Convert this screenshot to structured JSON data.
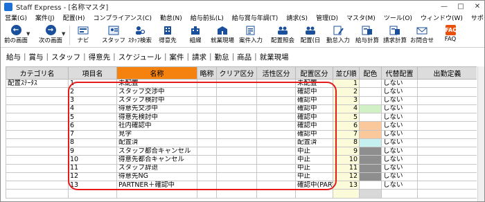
{
  "window": {
    "title": "Staff Express - [名称マスタ]"
  },
  "window_buttons": [
    "—",
    "□",
    "✕"
  ],
  "menu": [
    "営業(G)",
    "案件(J)",
    "配置(H)",
    "コンプライアンス(C)",
    "勤怠(N)",
    "給与前払(L)",
    "給与賞与年調(T)",
    "請求(S)",
    "管理(D)",
    "マスタ(M)",
    "ツール(O)",
    "ウィンドウ(W)",
    "サポート(H)"
  ],
  "toolbar": {
    "prev": "前の画面",
    "next": "次の画面",
    "navi": "ナビ",
    "staff": "スタッフ",
    "staff_search": "ｽﾀｯﾌ検索",
    "client": "得意先",
    "org": "組織",
    "workplace": "就業現場",
    "case_input": "案件入力",
    "place_confirm": "配置照会",
    "place_day": "配置(日",
    "attendance_input": "勤怠入力",
    "pay_calc": "給与計算",
    "bill_calc": "請求計算",
    "contact": "お問合せ",
    "faq": "FAQ",
    "faq_icon_text": "FAQ"
  },
  "tabs": [
    "給与",
    "賞与",
    "スタッフ",
    "得意先",
    "スケジュール",
    "案件",
    "請求",
    "勤怠",
    "商品",
    "就業現場"
  ],
  "grid": {
    "headers": [
      "カテゴリ名",
      "項目名",
      "名称",
      "略称",
      "クリア区分",
      "活性区分",
      "配置区分",
      "並び順",
      "配色",
      "代替配置",
      "出勤定義"
    ],
    "category": "配置ｽﾃｰﾀｽ",
    "rows": [
      {
        "item": "1",
        "name": "未配置",
        "haichi": "未配置",
        "order": "1",
        "color": "",
        "daitai": "しない"
      },
      {
        "item": "2",
        "name": "スタッフ交渉中",
        "haichi": "確認中",
        "order": "2",
        "color": "",
        "daitai": "しない"
      },
      {
        "item": "3",
        "name": "スタッフ検討中",
        "haichi": "確認中",
        "order": "3",
        "color": "",
        "daitai": "しない"
      },
      {
        "item": "4",
        "name": "得意先交渉中",
        "haichi": "確認中",
        "order": "4",
        "color": "green",
        "daitai": "しない"
      },
      {
        "item": "5",
        "name": "得意先検討中",
        "haichi": "確認中",
        "order": "5",
        "color": "",
        "daitai": "しない"
      },
      {
        "item": "6",
        "name": "社内確認中",
        "haichi": "確認中",
        "order": "6",
        "color": "orange",
        "daitai": "しない"
      },
      {
        "item": "7",
        "name": "見学",
        "haichi": "確認中",
        "order": "7",
        "color": "orange",
        "daitai": "しない"
      },
      {
        "item": "8",
        "name": "配置済",
        "haichi": "配置済",
        "order": "8",
        "color": "cyan",
        "daitai": "しない"
      },
      {
        "item": "9",
        "name": "スタッフ都合キャンセル",
        "haichi": "中止",
        "order": "9",
        "color": "dgray",
        "daitai": "しない"
      },
      {
        "item": "10",
        "name": "得意先都合キャンセル",
        "haichi": "中止",
        "order": "10",
        "color": "dgray",
        "daitai": "しない"
      },
      {
        "item": "11",
        "name": "スタッフ辞退",
        "haichi": "中止",
        "order": "11",
        "color": "dgray",
        "daitai": "しない"
      },
      {
        "item": "12",
        "name": "得意先NG",
        "haichi": "中止",
        "order": "12",
        "color": "dgray",
        "daitai": "しない"
      },
      {
        "item": "13",
        "name": "PARTNER＋確認中",
        "haichi": "確認中(PART",
        "order": "13",
        "color": "",
        "daitai": "しない"
      },
      {
        "item": "",
        "name": "",
        "haichi": "",
        "order": "",
        "color": "lgray",
        "daitai": ""
      }
    ]
  },
  "colors": {
    "accent_header": "#f5820f",
    "highlight_box": "#e41b1b",
    "row_yellow": "#fbfbd9"
  }
}
